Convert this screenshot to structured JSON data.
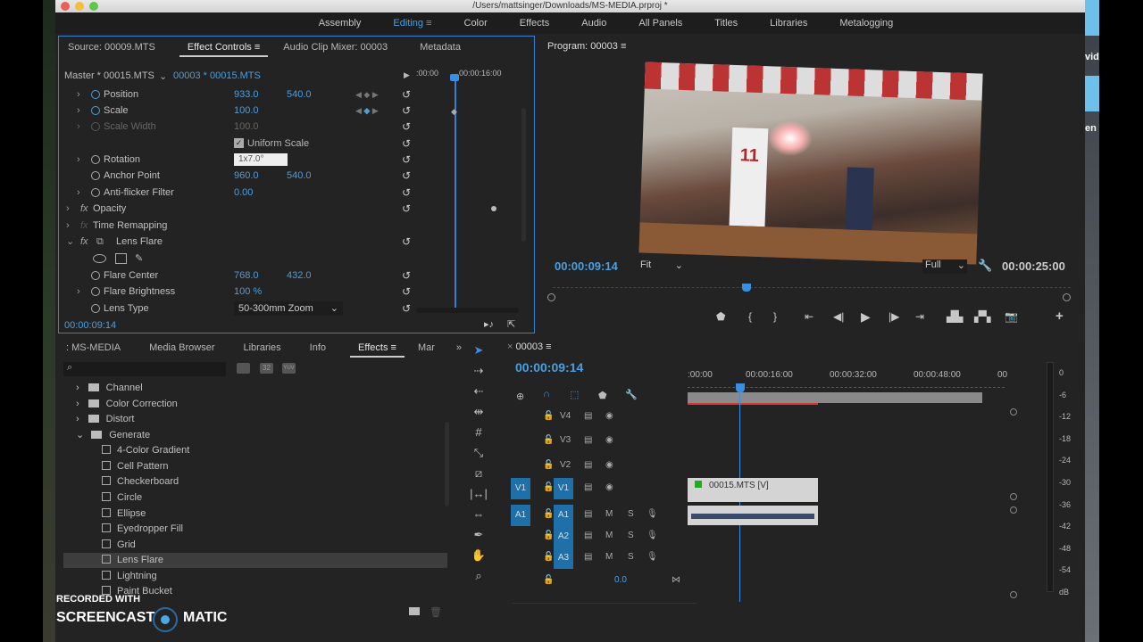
{
  "window": {
    "title": "/Users/mattsinger/Downloads/MS-MEDIA.prproj *"
  },
  "desktop": {
    "right_text_1": "vid",
    "right_text_2": "en"
  },
  "workspaces": [
    "Assembly",
    "Editing",
    "Color",
    "Effects",
    "Audio",
    "All Panels",
    "Titles",
    "Libraries",
    "Metalogging"
  ],
  "effect_controls": {
    "tabs": [
      "Source: 00009.MTS",
      "Effect Controls",
      "Audio Clip Mixer: 00003",
      "Metadata"
    ],
    "master": "Master * 00015.MTS",
    "clip": "00003 * 00015.MTS",
    "ruler": [
      ":00:00",
      "00:00:16:00"
    ],
    "rows": [
      {
        "label": "Position",
        "v1": "933.0",
        "v2": "540.0"
      },
      {
        "label": "Scale",
        "v1": "100.0"
      },
      {
        "label": "Scale Width",
        "v1": "100.0"
      },
      {
        "label": "Uniform Scale"
      },
      {
        "label": "Rotation",
        "v1": "1x7.0°"
      },
      {
        "label": "Anchor Point",
        "v1": "960.0",
        "v2": "540.0"
      },
      {
        "label": "Anti-flicker Filter",
        "v1": "0.00"
      },
      {
        "label": "Opacity"
      },
      {
        "label": "Time Remapping"
      },
      {
        "label": "Lens Flare"
      },
      {
        "label": "Flare Center",
        "v1": "768.0",
        "v2": "432.0"
      },
      {
        "label": "Flare Brightness",
        "v1": "100 %"
      },
      {
        "label": "Lens Type",
        "v1": "50-300mm Zoom"
      }
    ],
    "timecode": "00:00:09:14"
  },
  "program": {
    "title": "Program: 00003",
    "timecode": "00:00:09:14",
    "fit": "Fit",
    "quality": "Full",
    "duration": "00:00:25:00",
    "jersey": "11"
  },
  "project": {
    "tabs": [
      ": MS-MEDIA",
      "Media Browser",
      "Libraries",
      "Info",
      "Effects",
      "Mar"
    ],
    "icons": [
      "32",
      "YUV"
    ],
    "items": [
      {
        "label": "Channel",
        "type": "folder",
        "expanded": false
      },
      {
        "label": "Color Correction",
        "type": "folder",
        "expanded": false
      },
      {
        "label": "Distort",
        "type": "folder",
        "expanded": false
      },
      {
        "label": "Generate",
        "type": "folder",
        "expanded": true
      },
      {
        "label": "4-Color Gradient",
        "type": "effect"
      },
      {
        "label": "Cell Pattern",
        "type": "effect"
      },
      {
        "label": "Checkerboard",
        "type": "effect"
      },
      {
        "label": "Circle",
        "type": "effect"
      },
      {
        "label": "Ellipse",
        "type": "effect"
      },
      {
        "label": "Eyedropper Fill",
        "type": "effect"
      },
      {
        "label": "Grid",
        "type": "effect"
      },
      {
        "label": "Lens Flare",
        "type": "effect",
        "selected": true
      },
      {
        "label": "Lightning",
        "type": "effect"
      },
      {
        "label": "Paint Bucket",
        "type": "effect"
      }
    ]
  },
  "timeline": {
    "title": "00003",
    "timecode": "00:00:09:14",
    "ruler": [
      ":00:00",
      "00:00:16:00",
      "00:00:32:00",
      "00:00:48:00",
      "00"
    ],
    "video_tracks": [
      "V4",
      "V3",
      "V2",
      "V1"
    ],
    "source_v": "V1",
    "audio_tracks": [
      "A1",
      "A2",
      "A3"
    ],
    "source_a": "A1",
    "m": "M",
    "s": "S",
    "master_vol": "0.0",
    "clip_v": "00015.MTS [V]"
  },
  "meter": {
    "labels": [
      "0",
      "-6",
      "-12",
      "-18",
      "-24",
      "-30",
      "-36",
      "-42",
      "-48",
      "-54",
      "dB"
    ]
  },
  "watermark": {
    "line1": "RECORDED WITH",
    "line2": "SCREENCAST",
    "line3": "MATIC"
  }
}
